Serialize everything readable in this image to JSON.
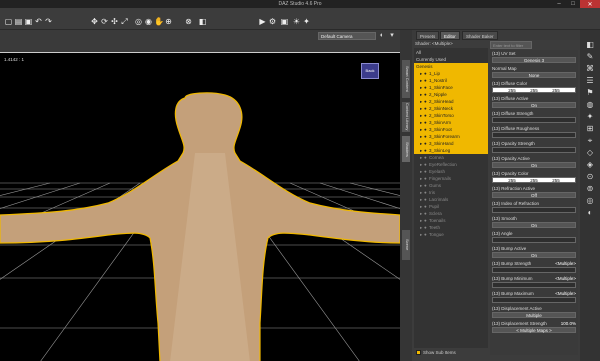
{
  "window": {
    "title": "DAZ Studio 4.6 Pro",
    "minimize": "–",
    "maximize": "□",
    "close": "✕"
  },
  "toolbar": {
    "icons": [
      "new-icon",
      "open-icon",
      "save-icon",
      "undo-icon",
      "redo-icon",
      "select-icon",
      "rotate-icon",
      "translate-icon",
      "scale-icon",
      "node-select-icon",
      "surface-select-icon",
      "pose-icon",
      "joint-icon",
      "weight-icon",
      "tube-icon",
      "render-icon",
      "render-settings-icon",
      "camera-icon",
      "spot-icon",
      "light-icon"
    ]
  },
  "viewport": {
    "camera_label": "Default Camera",
    "camera_options": [
      "Default Camera"
    ],
    "aspect_label": "1.4142 : 1",
    "cube_label": "Back",
    "accent_color": "#f0b800"
  },
  "side_tabs": [
    "Smart Content",
    "Content Library",
    "Shaders",
    "Scene"
  ],
  "panel": {
    "tabs": [
      "Presets",
      "Editor",
      "Shader Baker"
    ],
    "active_tab": "Editor",
    "shader_label": "Shader: <Multiple>",
    "filter_placeholder": "Enter text to filter by...",
    "tree_items": [
      {
        "label": "All",
        "state": "normal",
        "node": false
      },
      {
        "label": "Currently Used",
        "state": "normal",
        "node": false
      },
      {
        "label": "Genesis",
        "state": "sel",
        "node": false
      },
      {
        "label": "1_Lip",
        "state": "sel",
        "node": true
      },
      {
        "label": "1_Nostril",
        "state": "sel",
        "node": true
      },
      {
        "label": "1_SkinFace",
        "state": "sel",
        "node": true
      },
      {
        "label": "2_Nipple",
        "state": "sel",
        "node": true
      },
      {
        "label": "2_SkinHead",
        "state": "sel",
        "node": true
      },
      {
        "label": "2_SkinNeck",
        "state": "sel",
        "node": true
      },
      {
        "label": "2_SkinTorso",
        "state": "sel",
        "node": true
      },
      {
        "label": "3_SkinArm",
        "state": "sel",
        "node": true
      },
      {
        "label": "3_SkinFoot",
        "state": "sel",
        "node": true
      },
      {
        "label": "3_SkinForearm",
        "state": "sel",
        "node": true
      },
      {
        "label": "3_SkinHand",
        "state": "sel",
        "node": true
      },
      {
        "label": "3_SkinLeg",
        "state": "sel",
        "node": true
      },
      {
        "label": "Cornea",
        "state": "dim",
        "node": true
      },
      {
        "label": "EyeReflection",
        "state": "dim",
        "node": true
      },
      {
        "label": "Eyelash",
        "state": "dim",
        "node": true
      },
      {
        "label": "Fingernails",
        "state": "dim",
        "node": true
      },
      {
        "label": "Gums",
        "state": "dim",
        "node": true
      },
      {
        "label": "Iris",
        "state": "dim",
        "node": true
      },
      {
        "label": "Lacrimals",
        "state": "dim",
        "node": true
      },
      {
        "label": "Pupil",
        "state": "dim",
        "node": true
      },
      {
        "label": "Sclera",
        "state": "dim",
        "node": true
      },
      {
        "label": "Toenails",
        "state": "dim",
        "node": true
      },
      {
        "label": "Teeth",
        "state": "dim",
        "node": true
      },
      {
        "label": "Tongue",
        "state": "dim",
        "node": true
      }
    ],
    "show_sub_items": "Show Sub Items",
    "properties": [
      {
        "kind": "label",
        "text": "(13) UV Set"
      },
      {
        "kind": "box",
        "text": "Genesis 3",
        "style": "normal"
      },
      {
        "kind": "label",
        "text": "Normal Map"
      },
      {
        "kind": "box",
        "text": "None",
        "style": "normal"
      },
      {
        "kind": "label",
        "text": "(13) Diffuse Color"
      },
      {
        "kind": "color",
        "values": [
          "255",
          "255",
          "255"
        ]
      },
      {
        "kind": "label",
        "text": "(13) Diffuse Active"
      },
      {
        "kind": "box",
        "text": "On",
        "style": "normal"
      },
      {
        "kind": "label",
        "text": "(13) Diffuse Strength"
      },
      {
        "kind": "box",
        "text": "",
        "style": "dark"
      },
      {
        "kind": "label",
        "text": "(13) Diffuse Roughness"
      },
      {
        "kind": "box",
        "text": "",
        "style": "dark"
      },
      {
        "kind": "label",
        "text": "(13) Opacity Strength"
      },
      {
        "kind": "box",
        "text": "",
        "style": "dark"
      },
      {
        "kind": "label",
        "text": "(13) Opacity Active"
      },
      {
        "kind": "box",
        "text": "On",
        "style": "normal"
      },
      {
        "kind": "label",
        "text": "(13) Opacity Color"
      },
      {
        "kind": "color",
        "values": [
          "255",
          "255",
          "255"
        ]
      },
      {
        "kind": "label",
        "text": "(13) Refraction Active"
      },
      {
        "kind": "box",
        "text": "Off",
        "style": "normal"
      },
      {
        "kind": "label",
        "text": "(13) Index of Refraction"
      },
      {
        "kind": "box",
        "text": "",
        "style": "dark"
      },
      {
        "kind": "label",
        "text": "(13) Smooth"
      },
      {
        "kind": "box",
        "text": "On",
        "style": "normal"
      },
      {
        "kind": "label",
        "text": "(13) Angle"
      },
      {
        "kind": "box",
        "text": "",
        "style": "dark"
      },
      {
        "kind": "label",
        "text": "(13) Bump Active"
      },
      {
        "kind": "box",
        "text": "On",
        "style": "normal"
      },
      {
        "kind": "label",
        "text": "(13) Bump Strength",
        "value": "<Multiple>"
      },
      {
        "kind": "box",
        "text": "",
        "style": "dark"
      },
      {
        "kind": "label",
        "text": "(13) Bump Minimum",
        "value": "<Multiple>"
      },
      {
        "kind": "box",
        "text": "",
        "style": "dark"
      },
      {
        "kind": "label",
        "text": "(13) Bump Maximum",
        "value": "<Multiple>"
      },
      {
        "kind": "box",
        "text": "",
        "style": "dark"
      },
      {
        "kind": "label",
        "text": "(13) Displacement Active"
      },
      {
        "kind": "box",
        "text": "Multiple",
        "style": "normal"
      },
      {
        "kind": "label",
        "text": "(13) Displacement Strength",
        "value": "100.0%"
      },
      {
        "kind": "box",
        "text": "< Multiple Maps >",
        "style": "normal"
      }
    ]
  },
  "right_tools": [
    "tool-1-icon",
    "tool-2-icon",
    "tool-3-icon",
    "tool-4-icon",
    "tool-5-icon",
    "tool-6-icon",
    "tool-7-icon",
    "tool-8-icon",
    "tool-9-icon",
    "tool-10-icon",
    "tool-11-icon",
    "tool-12-icon",
    "tool-13-icon",
    "tool-14-icon",
    "tool-15-icon"
  ]
}
